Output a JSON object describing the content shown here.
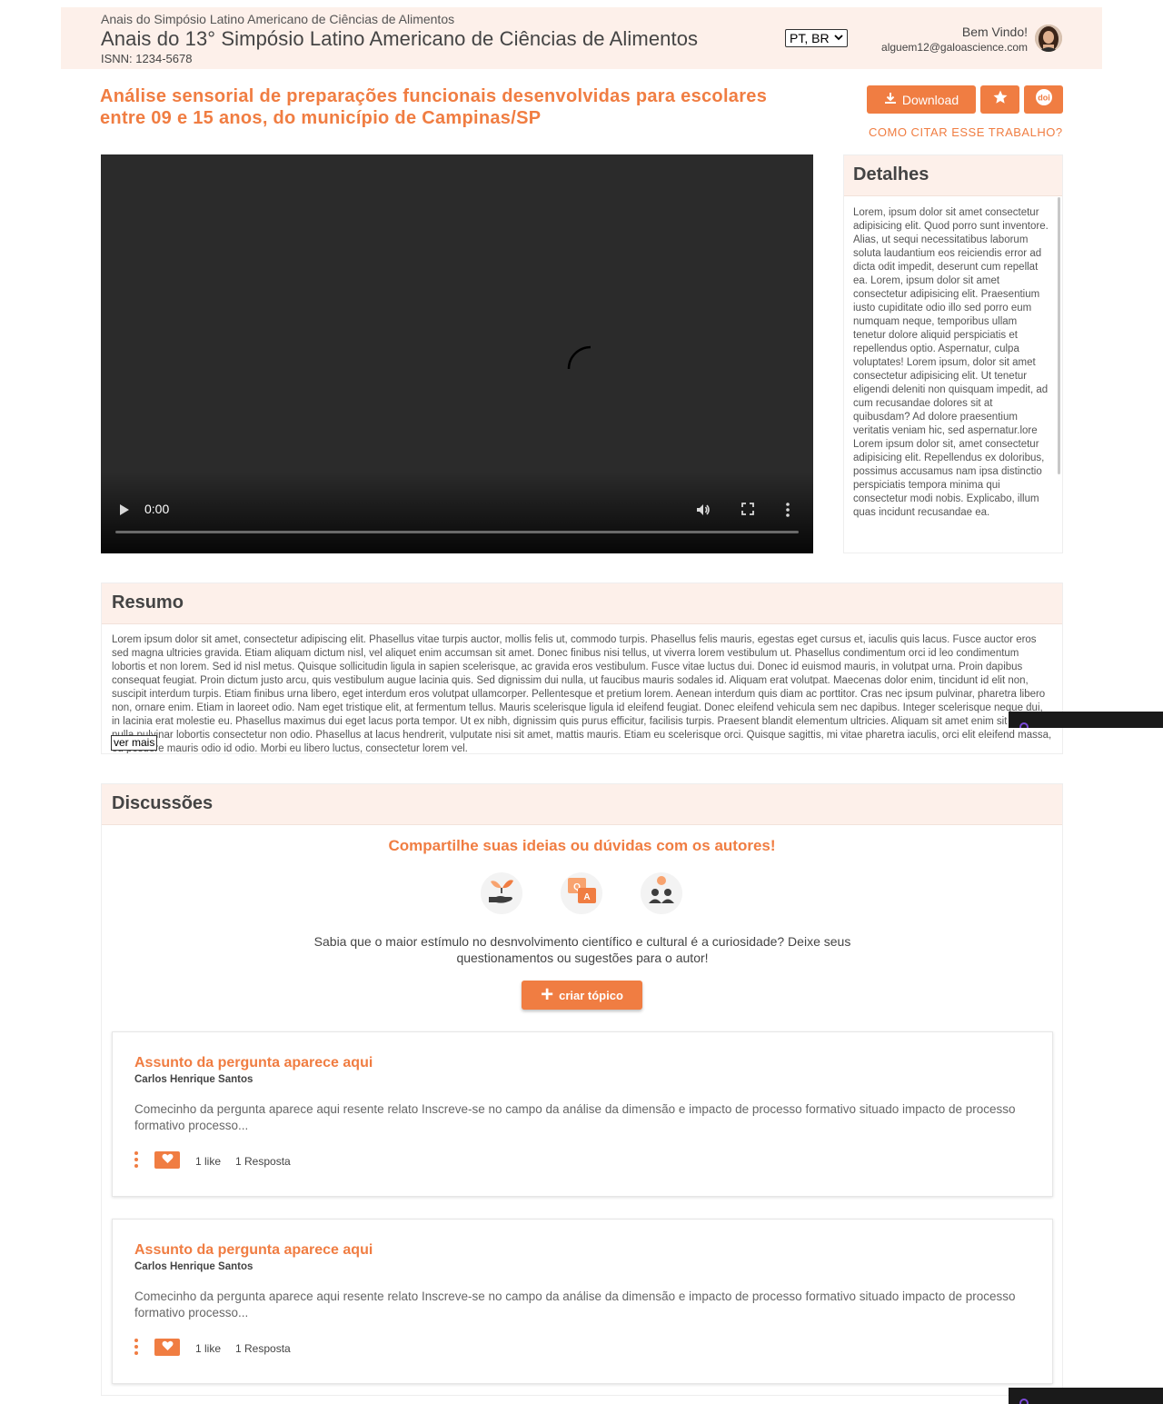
{
  "header": {
    "small_title": "Anais do Simpósio Latino Americano de Ciências de Alimentos",
    "main_title": "Anais do 13° Simpósio Latino Americano de Ciências de Alimentos",
    "issn": "ISNN: 1234-5678",
    "language": "PT, BR",
    "welcome": "Bem Vindo!",
    "email": "alguem12@galoascience.com"
  },
  "paper": {
    "title": "Análise sensorial de preparações funcionais desenvolvidas para escolares entre 09 e 15 anos, do município de Campinas/SP",
    "download_label": "Download",
    "cite_label": "COMO CITAR ESSE TRABALHO?"
  },
  "video": {
    "time": "0:00",
    "progress": 0
  },
  "details": {
    "heading": "Detalhes",
    "text": "Lorem, ipsum dolor sit amet consectetur adipisicing elit. Quod porro sunt inventore. Alias, ut sequi necessitatibus laborum soluta laudantium eos reiciendis error ad dicta odit impedit, deserunt cum repellat ea. Lorem, ipsum dolor sit amet consectetur adipisicing elit. Praesentium iusto cupiditate odio illo sed porro eum numquam neque, temporibus ullam tenetur dolore aliquid perspiciatis et repellendus optio. Aspernatur, culpa voluptates! Lorem ipsum, dolor sit amet consectetur adipisicing elit. Ut tenetur eligendi deleniti non quisquam impedit, ad cum recusandae dolores sit at quibusdam? Ad dolore praesentium veritatis veniam hic, sed aspernatur.lore Lorem ipsum dolor sit, amet consectetur adipisicing elit. Repellendus ex doloribus, possimus accusamus nam ipsa distinctio perspiciatis tempora minima qui consectetur modi nobis. Explicabo, illum quas incidunt recusandae ea."
  },
  "resumo": {
    "heading": "Resumo",
    "text": "Lorem ipsum dolor sit amet, consectetur adipiscing elit. Phasellus vitae turpis auctor, mollis felis ut, commodo turpis. Phasellus felis mauris, egestas eget cursus et, iaculis quis lacus. Fusce auctor eros sed magna ultricies gravida. Etiam aliquam dictum nisl, vel aliquet enim accumsan sit amet. Donec finibus nisi tellus, ut viverra lorem vestibulum ut. Phasellus condimentum orci id leo condimentum lobortis et non lorem. Sed id nisl metus. Quisque sollicitudin ligula in sapien scelerisque, ac gravida eros vestibulum. Fusce vitae luctus dui. Donec id euismod mauris, in volutpat urna. Proin dapibus consequat feugiat. Proin dictum justo arcu, quis vestibulum augue lacinia quis. Sed dignissim dui nulla, ut faucibus mauris sodales id. Aliquam erat volutpat. Maecenas dolor enim, tincidunt id elit non, suscipit interdum turpis. Etiam finibus urna libero, eget interdum eros volutpat ullamcorper. Pellentesque et pretium lorem. Aenean interdum quis diam ac porttitor. Cras nec ipsum pulvinar, pharetra libero non, ornare enim. Etiam in laoreet odio. Nam eget tristique elit, at fermentum tellus. Mauris scelerisque ligula id eleifend feugiat. Donec eleifend vehicula sem nec dapibus. Integer scelerisque neque dui, in lacinia erat molestie eu. Phasellus maximus dui eget lacus porta tempor. Ut ex nibh, dignissim quis purus efficitur, facilisis turpis. Praesent blandit elementum ultricies. Aliquam sit amet enim sit amet nulla pulvinar lobortis consectetur non odio. Phasellus at lacus hendrerit, vulputate nisi sit amet, mattis mauris. Etiam eu scelerisque orci. Quisque sagittis, mi vitae pharetra iaculis, orci elit eleifend massa, eu posuere mauris odio id odio. Morbi eu libero luctus, consectetur lorem vel.",
    "more_label": "ver mais"
  },
  "discussoes": {
    "heading": "Discussões",
    "tagline": "Compartilhe suas ideias ou dúvidas com os autores!",
    "description": "Sabia que o maior estímulo no desnvolvimento científico e cultural é a curiosidade? Deixe seus questionamentos ou sugestões para o autor!",
    "create_label": "criar tópico",
    "icons": [
      "plant-hand-icon",
      "qa-bubbles-icon",
      "audience-icon"
    ],
    "topics": [
      {
        "title": "Assunto da pergunta aparece aqui",
        "author": "Carlos Henrique Santos",
        "excerpt": "Comecinho da pergunta aparece aqui resente relato Inscreve-se no campo da análise da dimensão e impacto de processo formativo situado impacto de processo formativo processo...",
        "likes": "1 like",
        "replies": "1 Resposta"
      },
      {
        "title": "Assunto da pergunta aparece aqui",
        "author": "Carlos Henrique Santos",
        "excerpt": "Comecinho da pergunta aparece aqui resente relato Inscreve-se no campo da análise da dimensão e impacto de processo formativo situado impacto de processo formativo processo...",
        "likes": "1 like",
        "replies": "1 Resposta"
      }
    ]
  },
  "colors": {
    "accent": "#f07d42",
    "header_bg": "#fdf0ea",
    "video_bg": "#2b2b2b"
  }
}
